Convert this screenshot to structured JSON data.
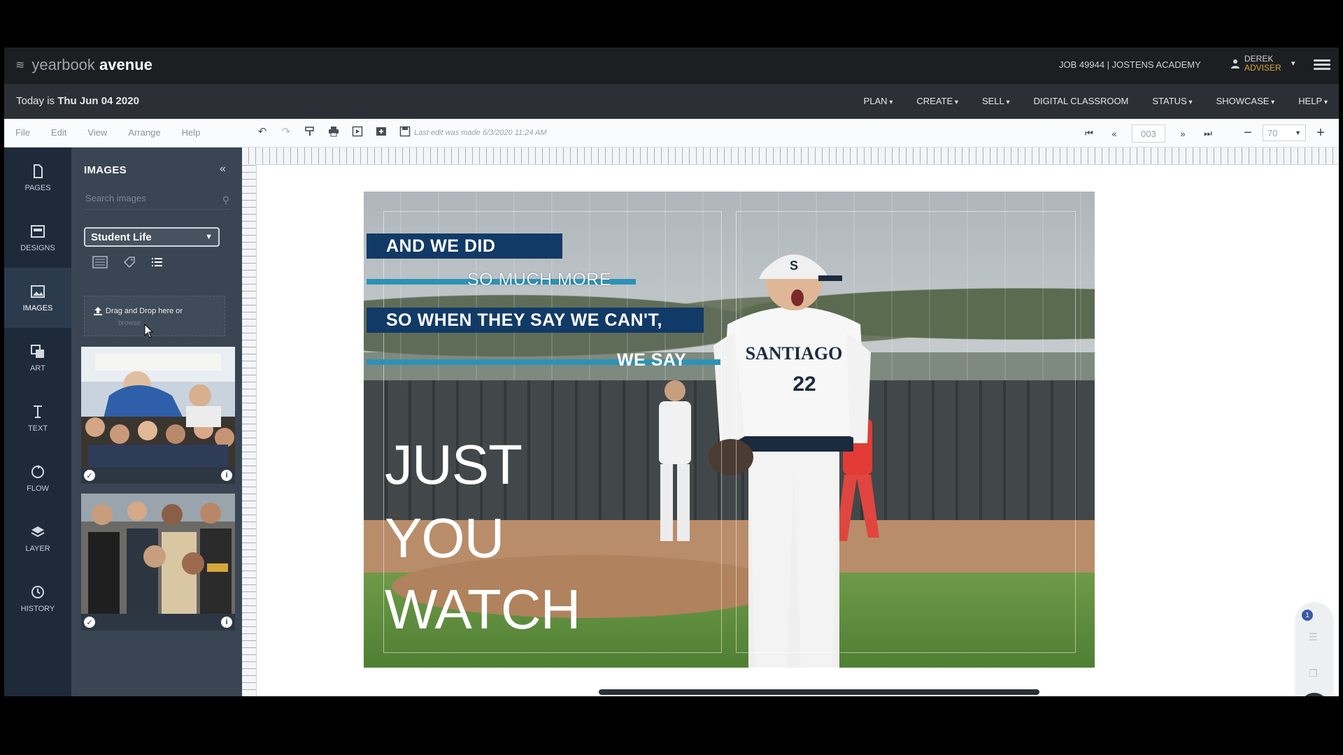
{
  "header": {
    "logo_light": "yearbook",
    "logo_bold": "avenue",
    "job": "JOB 49944 | JOSTENS ACADEMY",
    "user_first": "DEREK",
    "user_role": "ADVISER"
  },
  "navbar": {
    "today_prefix": "Today is",
    "today_date": "Thu Jun 04 2020",
    "items": [
      "PLAN",
      "CREATE",
      "SELL",
      "DIGITAL CLASSROOM",
      "STATUS",
      "SHOWCASE",
      "HELP"
    ]
  },
  "toolbar": {
    "menus": [
      "File",
      "Edit",
      "View",
      "Arrange",
      "Help"
    ],
    "last_edit": "Last edit was made 6/3/2020 11:24 AM",
    "page_number": "003",
    "zoom": "70"
  },
  "rail": {
    "items": [
      "PAGES",
      "DESIGNS",
      "IMAGES",
      "ART",
      "TEXT",
      "FLOW",
      "LAYER",
      "HISTORY"
    ]
  },
  "panel": {
    "title": "IMAGES",
    "search_placeholder": "Search images",
    "folder": "Student Life",
    "drop_text": "Drag and Drop here or",
    "drop_link": "browse"
  },
  "spread": {
    "line1": "AND WE DID",
    "line2": "SO MUCH MORE",
    "line3": "SO WHEN THEY SAY WE CAN'T,",
    "line4": "WE SAY",
    "big1": "JUST",
    "big2": "YOU",
    "big3": "WATCH",
    "jersey": "SANTIAGO",
    "jersey_number": "22"
  },
  "chat": {
    "badge": "1"
  },
  "colors": {
    "topbar": "#1c1e22",
    "navbar": "#2c2f35",
    "rail": "#1e2a3a",
    "panel": "#3a4554",
    "banner_navy": "#123a66",
    "stripe_teal": "#2d92b5",
    "user_role": "#d6a73a"
  }
}
